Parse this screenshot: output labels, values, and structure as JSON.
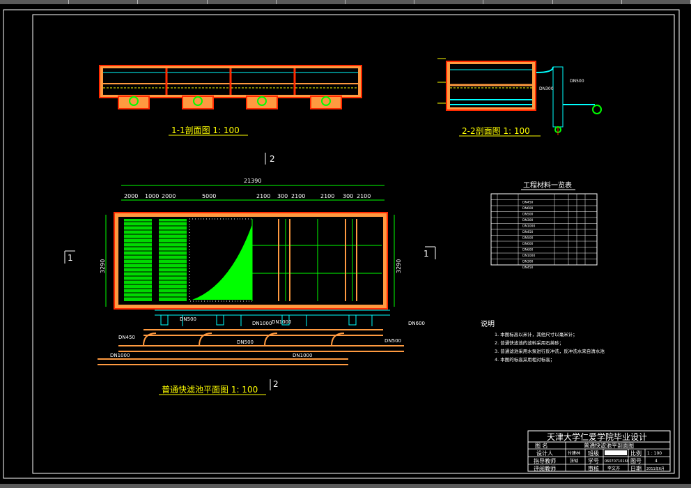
{
  "window": {
    "scroll_segments": 10
  },
  "section_1_1": {
    "title": "1-1剖面图  1: 100"
  },
  "section_2_2": {
    "title": "2-2剖面图  1: 100",
    "pipe_labels": [
      "DN500",
      "DN300"
    ]
  },
  "plan": {
    "title": "普通快滤池平面图 1: 100",
    "marker_1": "1",
    "marker_2": "2",
    "total_width": "21390",
    "dimensions": [
      "2000",
      "1000",
      "2000",
      "5000",
      "2100",
      "300",
      "2100",
      "2100",
      "300",
      "2100"
    ],
    "height_dims": [
      "3290",
      "3290"
    ],
    "pipe_labels": [
      "DN500",
      "DN1000",
      "DN1000",
      "DN450",
      "DN500",
      "DN500",
      "DN1000",
      "DN1000",
      "DN600"
    ]
  },
  "materials": {
    "title": "工程材料一览表",
    "rows": 12,
    "pipe_specs": [
      "DN450",
      "DN600",
      "DN500",
      "DN300",
      "DN1000",
      "DN450",
      "DN500",
      "DN600",
      "DN600",
      "DN1000",
      "DN300",
      "DN450"
    ]
  },
  "notes": {
    "heading": "说明",
    "items": [
      "1.  本图标高以米计，其他尺寸以毫米计；",
      "2.  普通快滤池的滤料采用石英砂；",
      "3.  普通滤池采用水泵进行反冲洗，反冲洗水来自清水池",
      "4.  本图的标高采用相对标高；"
    ]
  },
  "title_block": {
    "school": "天津大学仁爱学院毕业设计",
    "name_label": "图    名",
    "name_value": "普通快滤池平剖面图",
    "designer_label": "设计人",
    "designer_value": "付建林",
    "advisor_label": "指导教师",
    "advisor_value": "张钺",
    "reviewer_label": "评阅教师",
    "class_label": "班级",
    "id_label": "学号",
    "id_value": "06070710168",
    "audit_label": "审核",
    "audit_value": "李文亦",
    "scale_label": "比例",
    "scale_value": "1 : 100",
    "sheet_label": "图号",
    "sheet_value": "4",
    "date_label": "日期",
    "date_value": "2011年6月"
  },
  "colors": {
    "frame": "#ffffff",
    "wall": "#ff2a00",
    "fill": "#ff9a40",
    "green": "#00ff00",
    "yellow": "#ffff00",
    "cyan": "#00ffff",
    "magenta": "#ff00ff"
  }
}
